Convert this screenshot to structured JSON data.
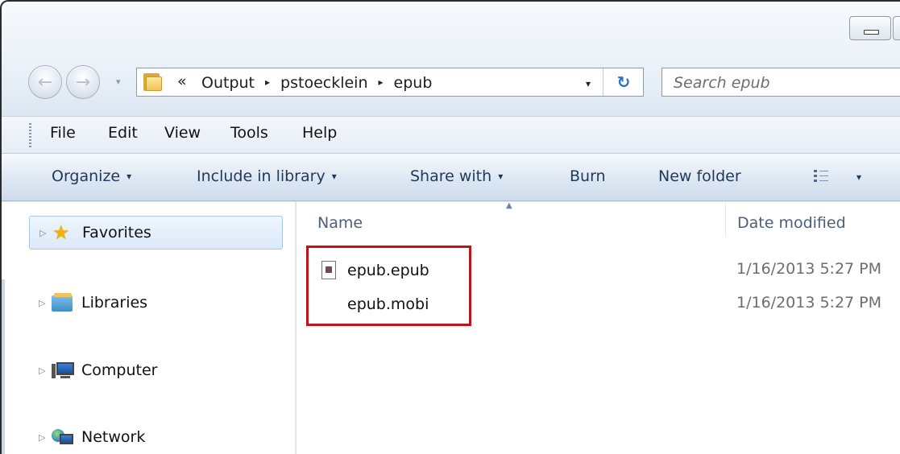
{
  "window": {
    "controls": [
      "minimize-icon",
      "maximize-icon"
    ]
  },
  "navigation": {
    "back_icon": "back-arrow-icon",
    "forward_icon": "forward-arrow-icon",
    "address": {
      "overflow_chevron": "«",
      "breadcrumbs": [
        "Output",
        "pstoecklein",
        "epub"
      ],
      "separator": "▸",
      "dropdown": "▾",
      "refresh_icon": "↻"
    },
    "search": {
      "placeholder": "Search epub"
    }
  },
  "menubar": {
    "items": [
      "File",
      "Edit",
      "View",
      "Tools",
      "Help"
    ]
  },
  "commandbar": {
    "organize": "Organize",
    "include_in_library": "Include in library",
    "share_with": "Share with",
    "burn": "Burn",
    "new_folder": "New folder",
    "caret": "▾"
  },
  "sidebar": {
    "items": [
      {
        "label": "Favorites",
        "icon": "star-icon",
        "selected": true
      },
      {
        "label": "Libraries",
        "icon": "libraries-icon"
      },
      {
        "label": "Computer",
        "icon": "computer-icon"
      },
      {
        "label": "Network",
        "icon": "network-icon"
      }
    ]
  },
  "filelist": {
    "columns": [
      "Name",
      "Date modified"
    ],
    "sort_indicator": "▲",
    "files": [
      {
        "name": "epub.epub",
        "date_modified": "1/16/2013 5:27 PM",
        "icon": "epub-file-icon"
      },
      {
        "name": "epub.mobi",
        "date_modified": "1/16/2013 5:27 PM",
        "icon": "mobi-file-icon"
      }
    ],
    "highlight_color": "#c0141c"
  }
}
